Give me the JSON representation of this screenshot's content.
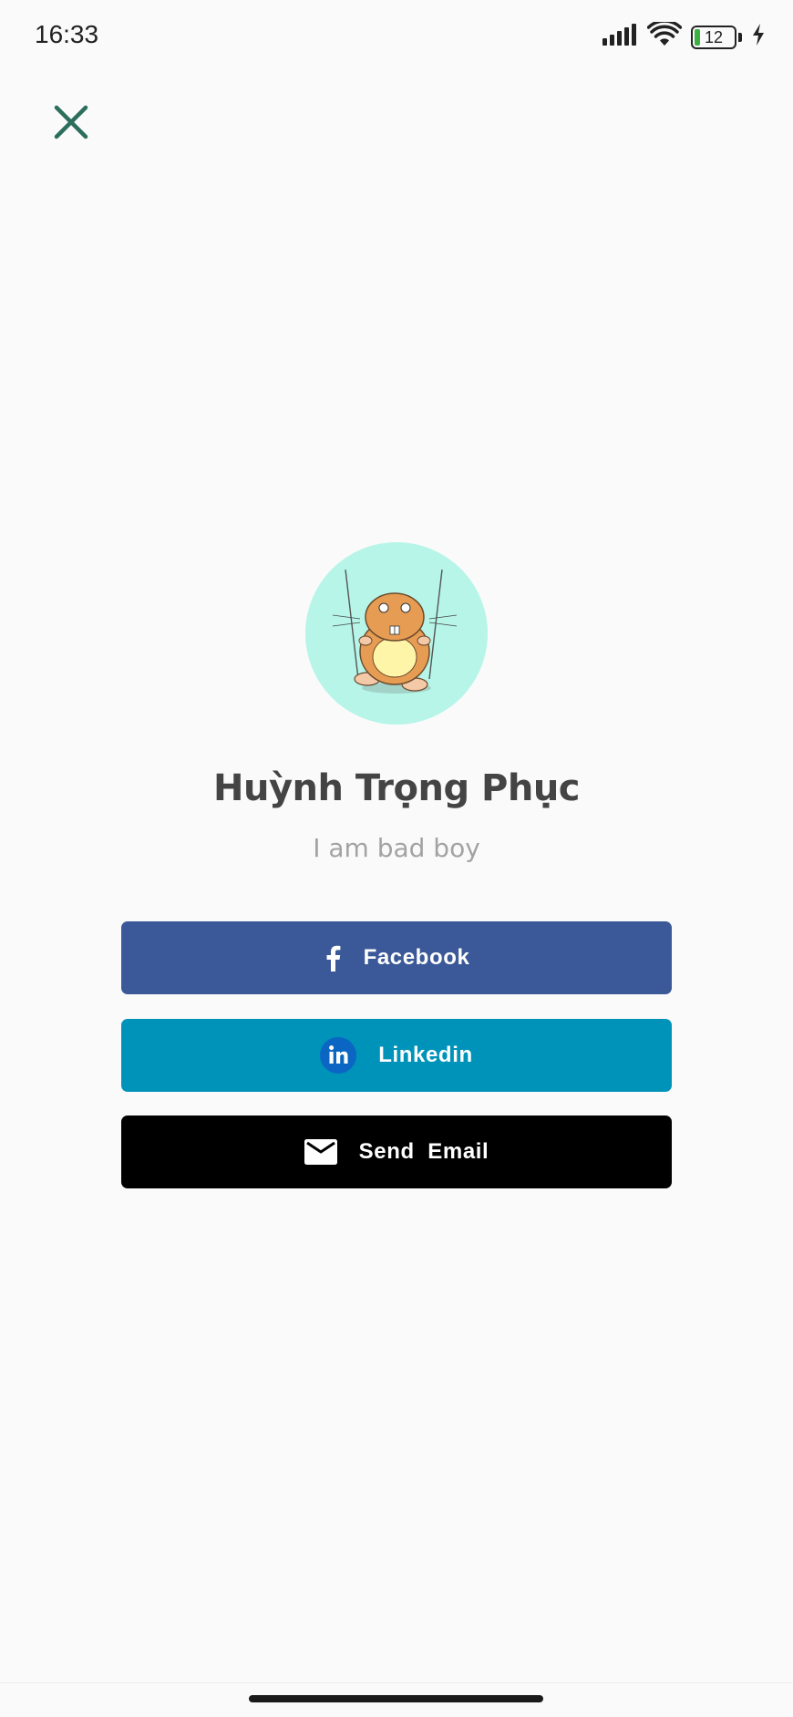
{
  "status_bar": {
    "time": "16:33",
    "battery_level": "12"
  },
  "profile": {
    "name": "Huỳnh Trọng Phục",
    "bio": "I am bad boy",
    "avatar_bg_color": "#b6f5e8"
  },
  "buttons": [
    {
      "label": "Facebook",
      "icon": "facebook-icon",
      "color": "#3b5998"
    },
    {
      "label": "Linkedin",
      "icon": "linkedin-icon",
      "color": "#0093b9"
    },
    {
      "label": "Send  Email",
      "icon": "mail-icon",
      "color": "#000000"
    }
  ],
  "colors": {
    "close_icon": "#2c6e5c",
    "background": "#fafafa"
  }
}
